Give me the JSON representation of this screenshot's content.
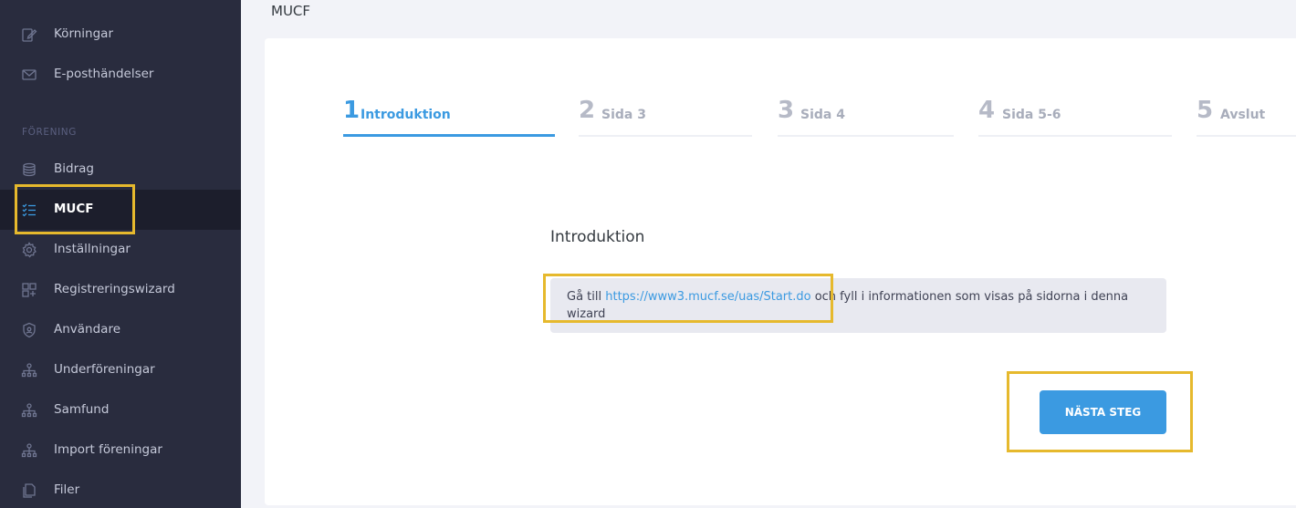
{
  "sidebar": {
    "items_top": [
      {
        "label": "Körningar",
        "icon": "edit-document-icon"
      },
      {
        "label": "E-posthändelser",
        "icon": "envelope-icon"
      }
    ],
    "section_label": "FÖRENING",
    "items": [
      {
        "label": "Bidrag",
        "icon": "coins-icon"
      },
      {
        "label": "MUCF",
        "icon": "checklist-icon",
        "active": true
      },
      {
        "label": "Inställningar",
        "icon": "gear-icon"
      },
      {
        "label": "Registreringswizard",
        "icon": "layout-grid-icon"
      },
      {
        "label": "Användare",
        "icon": "shield-icon"
      },
      {
        "label": "Underföreningar",
        "icon": "org-chart-icon"
      },
      {
        "label": "Samfund",
        "icon": "org-chart-icon"
      },
      {
        "label": "Import föreningar",
        "icon": "org-chart-icon"
      },
      {
        "label": "Filer",
        "icon": "files-icon"
      }
    ]
  },
  "header": {
    "title": "MUCF"
  },
  "wizard": {
    "steps": [
      {
        "number": "1",
        "label": "Introduktion",
        "active": true
      },
      {
        "number": "2",
        "label": "Sida 3"
      },
      {
        "number": "3",
        "label": "Sida 4"
      },
      {
        "number": "4",
        "label": "Sida 5-6"
      },
      {
        "number": "5",
        "label": "Avslut"
      }
    ],
    "section_title": "Introduktion",
    "info": {
      "prefix": "Gå till ",
      "link": "https://www3.mucf.se/uas/Start.do",
      "suffix": " och fyll i informationen som visas på sidorna i denna wizard"
    },
    "next_button": "NÄSTA STEG"
  },
  "colors": {
    "sidebar_bg": "#292c3e",
    "accent": "#3b9ae1",
    "highlight": "#e6b92d"
  }
}
